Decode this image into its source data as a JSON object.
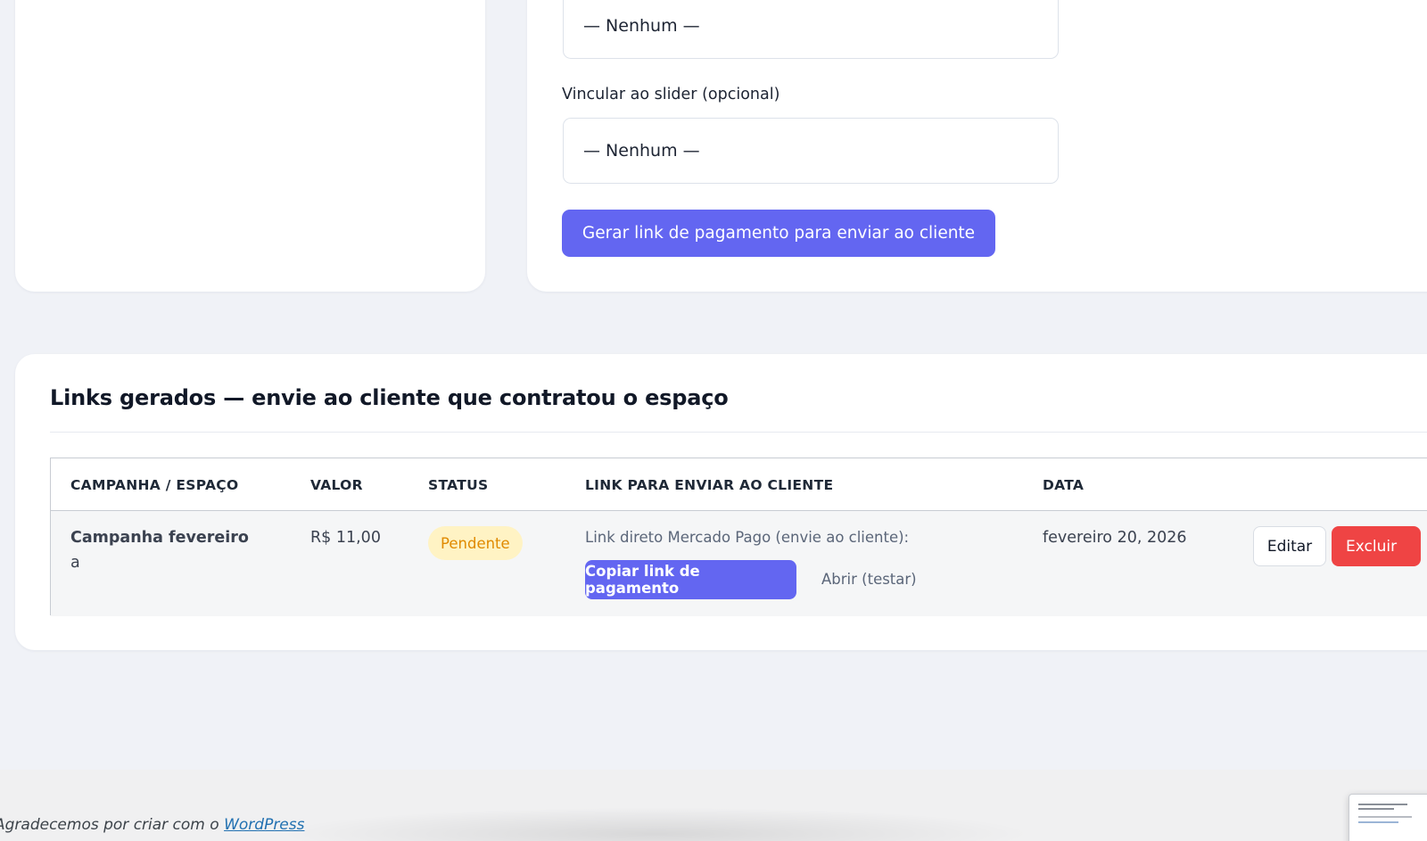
{
  "form": {
    "select_1_value": "— Nenhum —",
    "slider_label": "Vincular ao slider (opcional)",
    "select_2_value": "— Nenhum —",
    "generate_button": "Gerar link de pagamento para enviar ao cliente"
  },
  "links_section": {
    "title": "Links gerados — envie ao cliente que contratou o espaço",
    "columns": [
      "CAMPANHA / ESPAÇO",
      "VALOR",
      "STATUS",
      "LINK PARA ENVIAR AO CLIENTE",
      "DATA"
    ],
    "rows": [
      {
        "campaign": "Campanha fevereiro",
        "space": "a",
        "value": "R$ 11,00",
        "status": "Pendente",
        "link_description": "Link direto Mercado Pago (envie ao cliente):",
        "copy_button": "Copiar link de pagamento",
        "open_link": "Abrir (testar)",
        "date": "fevereiro 20, 2026",
        "edit_button": "Editar",
        "delete_button": "Excluir"
      }
    ]
  },
  "footer": {
    "text_prefix": "Agradecemos por criar com o",
    "link_text": "WordPress"
  },
  "colors": {
    "primary": "#6366f1",
    "danger": "#ef4444",
    "badge_bg": "#fff3c4",
    "badge_text": "#e08a00"
  }
}
